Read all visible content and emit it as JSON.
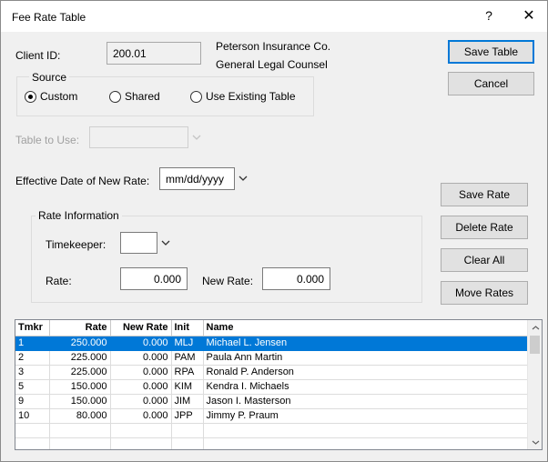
{
  "window": {
    "title": "Fee Rate Table",
    "help_glyph": "?",
    "close_glyph": "✕"
  },
  "client": {
    "label": "Client ID:",
    "value": "200.01",
    "name_line1": "Peterson Insurance Co.",
    "name_line2": "General Legal Counsel"
  },
  "source": {
    "title": "Source",
    "options": [
      {
        "label": "Custom",
        "checked": true
      },
      {
        "label": "Shared",
        "checked": false
      },
      {
        "label": "Use Existing Table",
        "checked": false
      }
    ]
  },
  "table_to_use": {
    "label": "Table to Use:",
    "value": ""
  },
  "effective_date": {
    "label": "Effective Date of New Rate:",
    "value": "mm/dd/yyyy"
  },
  "rate_info": {
    "title": "Rate Information",
    "timekeeper_label": "Timekeeper:",
    "timekeeper_value": "",
    "rate_label": "Rate:",
    "rate_value": "0.000",
    "new_rate_label": "New Rate:",
    "new_rate_value": "0.000"
  },
  "buttons": {
    "save_table": "Save Table",
    "cancel": "Cancel",
    "save_rate": "Save Rate",
    "delete_rate": "Delete Rate",
    "clear_all": "Clear All",
    "move_rates": "Move Rates"
  },
  "grid": {
    "columns": [
      "Tmkr",
      "Rate",
      "New Rate",
      "Init",
      "Name"
    ],
    "rows": [
      {
        "tmkr": "1",
        "rate": "250.000",
        "new_rate": "0.000",
        "init": "MLJ",
        "name": "Michael L. Jensen",
        "selected": true
      },
      {
        "tmkr": "2",
        "rate": "225.000",
        "new_rate": "0.000",
        "init": "PAM",
        "name": "Paula Ann Martin",
        "selected": false
      },
      {
        "tmkr": "3",
        "rate": "225.000",
        "new_rate": "0.000",
        "init": "RPA",
        "name": "Ronald P. Anderson",
        "selected": false
      },
      {
        "tmkr": "5",
        "rate": "150.000",
        "new_rate": "0.000",
        "init": "KIM",
        "name": "Kendra I. Michaels",
        "selected": false
      },
      {
        "tmkr": "9",
        "rate": "150.000",
        "new_rate": "0.000",
        "init": "JIM",
        "name": "Jason I. Masterson",
        "selected": false
      },
      {
        "tmkr": "10",
        "rate": "80.000",
        "new_rate": "0.000",
        "init": "JPP",
        "name": "Jimmy P. Praum",
        "selected": false
      },
      {
        "tmkr": "",
        "rate": "",
        "new_rate": "",
        "init": "",
        "name": "",
        "selected": false
      },
      {
        "tmkr": "",
        "rate": "",
        "new_rate": "",
        "init": "",
        "name": "",
        "selected": false
      }
    ]
  },
  "colors": {
    "accent": "#0078d7",
    "window_bg": "#f0f0f0",
    "button_bg": "#e1e1e1"
  },
  "icons": {
    "dropdown": "chevron-down-icon",
    "scroll_up": "chevron-up-icon",
    "scroll_down": "chevron-down-icon"
  }
}
